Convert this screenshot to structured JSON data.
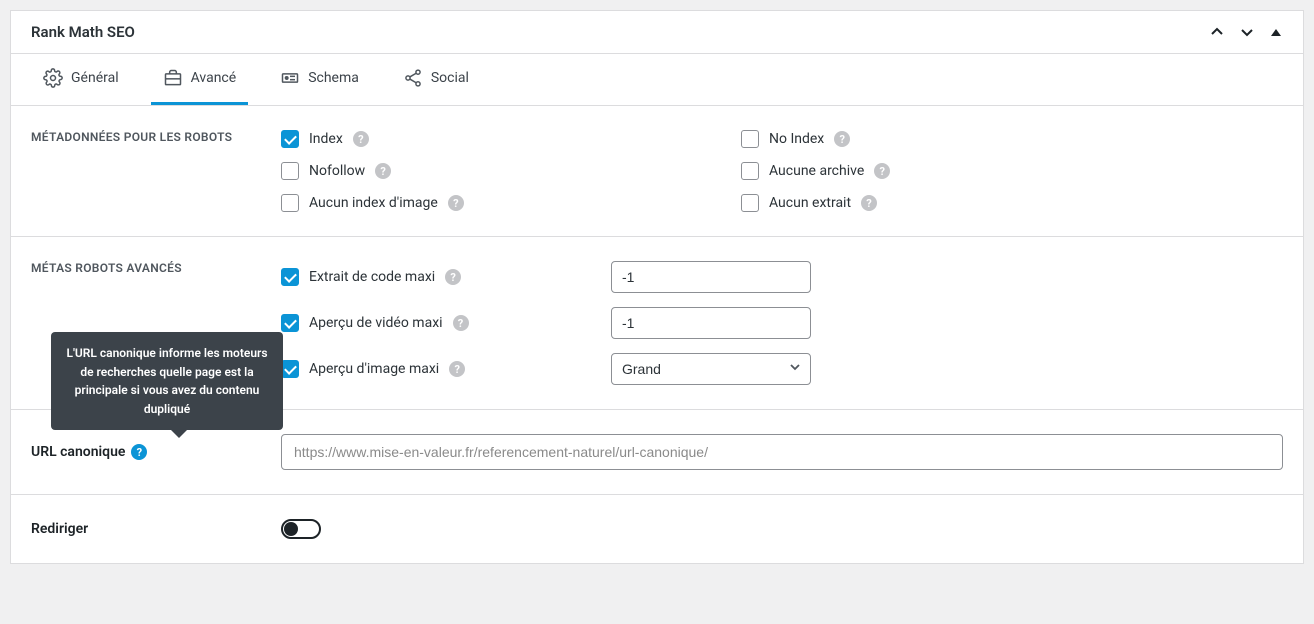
{
  "panel": {
    "title": "Rank Math SEO"
  },
  "tabs": {
    "general": "Général",
    "advanced": "Avancé",
    "schema": "Schema",
    "social": "Social"
  },
  "robots": {
    "section_label": "MÉTADONNÉES POUR LES ROBOTS",
    "items": {
      "index": "Index",
      "noindex": "No Index",
      "nofollow": "Nofollow",
      "noarchive": "Aucune archive",
      "noimageindex": "Aucun index d'image",
      "nosnippet": "Aucun extrait"
    }
  },
  "adv_robots": {
    "section_label": "MÉTAS ROBOTS AVANCÉS",
    "max_snippet_label": "Extrait de code maxi",
    "max_snippet_value": "-1",
    "max_video_label": "Aperçu de vidéo maxi",
    "max_video_value": "-1",
    "max_image_label": "Aperçu d'image maxi",
    "max_image_value": "Grand"
  },
  "canonical": {
    "label": "URL canonique",
    "placeholder": "https://www.mise-en-valeur.fr/referencement-naturel/url-canonique/",
    "tooltip": "L'URL canonique informe les moteurs de recherches quelle page est la principale si vous avez du contenu dupliqué"
  },
  "redirect": {
    "label": "Rediriger"
  },
  "help_glyph": "?"
}
